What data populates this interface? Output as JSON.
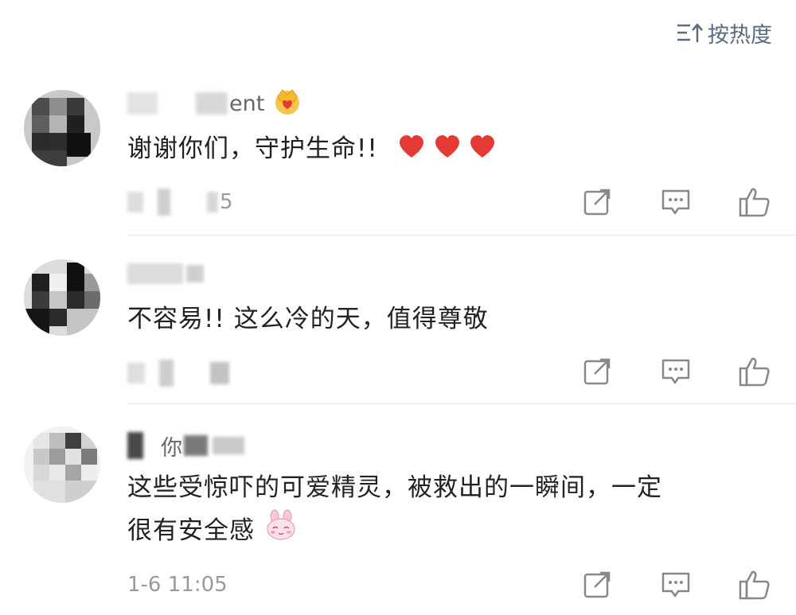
{
  "sort": {
    "label": "按热度",
    "icon": "sort-icon"
  },
  "comments": [
    {
      "username": "ent",
      "badge_icon": "crown-badge-icon",
      "text": "谢谢你们，守护生命!!",
      "emojis": [
        "heart",
        "heart",
        "heart"
      ],
      "time": "5",
      "actions": [
        "share-icon",
        "comment-icon",
        "like-icon"
      ]
    },
    {
      "username": "",
      "text": "不容易!! 这么冷的天，值得尊敬",
      "time": "",
      "actions": [
        "share-icon",
        "comment-icon",
        "like-icon"
      ]
    },
    {
      "username": "你",
      "text_line1": "这些受惊吓的可爱精灵，被救出的一瞬间，一定",
      "text_line2": "很有安全感",
      "emojis": [
        "bunny"
      ],
      "time": "1-6 11:05",
      "actions": [
        "share-icon",
        "comment-icon",
        "like-icon"
      ]
    }
  ],
  "colors": {
    "heart": "#e53935",
    "meta": "#999999",
    "sort": "#5b6b7d",
    "divider": "#e8e8e8"
  }
}
